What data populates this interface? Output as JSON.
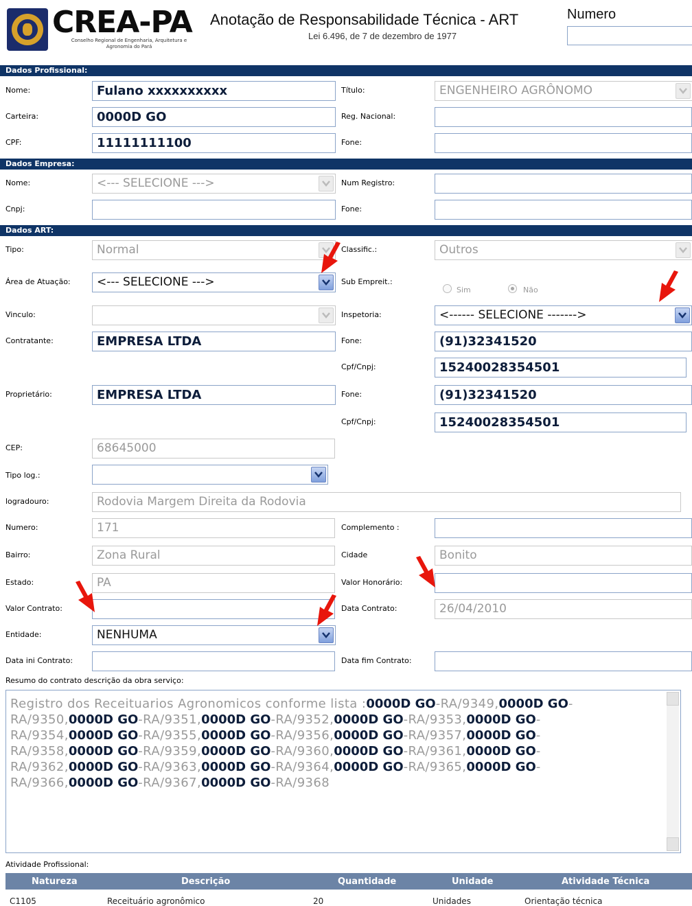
{
  "header": {
    "brand": "CREA-PA",
    "brand_sub": "Conselho Regional de Engenharia, Arquitetura e Agronomia do Pará",
    "title": "Anotação de Responsabilidade Técnica - ART",
    "law": "Lei 6.496, de 7 de dezembro de 1977",
    "numero_label": "Numero",
    "numero_value": ""
  },
  "profissional": {
    "section": "Dados Profissional:",
    "nome_label": "Nome:",
    "nome_value": "Fulano xxxxxxxxxx",
    "titulo_label": "Título:",
    "titulo_value": "ENGENHEIRO AGRÔNOMO",
    "carteira_label": "Carteira:",
    "carteira_value": "0000D GO",
    "reg_label": "Reg. Nacional:",
    "reg_value": "",
    "cpf_label": "CPF:",
    "cpf_value": "11111111100",
    "fone_label": "Fone:",
    "fone_value": ""
  },
  "empresa": {
    "section": "Dados Empresa:",
    "nome_label": "Nome:",
    "nome_value": "<--- SELECIONE --->",
    "num_label": "Num Registro:",
    "num_value": "",
    "cnpj_label": "Cnpj:",
    "cnpj_value": "",
    "fone_label": "Fone:",
    "fone_value": ""
  },
  "art": {
    "section": "Dados ART:",
    "tipo_label": "Tipo:",
    "tipo_value": "Normal",
    "classif_label": "Classific.:",
    "classif_value": "Outros",
    "area_label": "Área de Atuação:",
    "area_value": "<--- SELECIONE --->",
    "sub_label": "Sub Empreit.:",
    "sim_label": "Sim",
    "nao_label": "Não",
    "vinculo_label": "Vinculo:",
    "vinculo_value": "",
    "inspetoria_label": "Inspetoria:",
    "inspetoria_value": "<------ SELECIONE ------->",
    "contratante_label": "Contratante:",
    "contratante_value": "EMPRESA LTDA",
    "fone1_label": "Fone:",
    "fone1_value": "(91)32341520",
    "cpfcnpj1_label": "Cpf/Cnpj:",
    "cpfcnpj1_value": "15240028354501",
    "proprietario_label": "Proprietário:",
    "proprietario_value": "EMPRESA LTDA",
    "fone2_label": "Fone:",
    "fone2_value": "(91)32341520",
    "cpfcnpj2_label": "Cpf/Cnpj:",
    "cpfcnpj2_value": "15240028354501",
    "cep_label": "CEP:",
    "cep_value": "68645000",
    "tipolog_label": "Tipo log.:",
    "tipolog_value": "",
    "logradouro_label": "logradouro:",
    "logradouro_value": "Rodovia Margem Direita da Rodovia",
    "numero_label": "Numero:",
    "numero_value": "171",
    "complemento_label": "Complemento :",
    "complemento_value": "",
    "bairro_label": "Bairro:",
    "bairro_value": "Zona Rural",
    "cidade_label": "Cidade",
    "cidade_value": "Bonito",
    "estado_label": "Estado:",
    "estado_value": "PA",
    "honorario_label": "Valor Honorário:",
    "honorario_value": "",
    "valor_label": "Valor Contrato:",
    "valor_value": "",
    "data_contrato_label": "Data Contrato:",
    "data_contrato_value": "26/04/2010",
    "entidade_label": "Entidade:",
    "entidade_value": "NENHUMA",
    "data_ini_label": "Data ini Contrato:",
    "data_ini_value": "",
    "data_fim_label": "Data fim Contrato:",
    "data_fim_value": "",
    "resumo_label": "Resumo do contrato descrição da obra serviço:",
    "resumo_intro": "Registro dos Receituarios Agronomicos conforme lista :",
    "resumo_code": "0000D GO",
    "resumo_items": [
      "-RA/9349,",
      "-RA/9350,",
      "-RA/9351,",
      "-RA/9352,",
      "-RA/9353,",
      "-RA/9354,",
      "-RA/9355,",
      "-RA/9356,",
      "-RA/9357,",
      "-RA/9358,",
      "-RA/9359,",
      "-RA/9360,",
      "-RA/9361,",
      "-RA/9362,",
      "-RA/9363,",
      "-RA/9364,",
      "-RA/9365,",
      "-RA/9366,",
      "-RA/9367,",
      "-RA/9368"
    ]
  },
  "atividade": {
    "label": "Atividade Profissional:",
    "headers": [
      "Natureza",
      "Descrição",
      "Quantidade",
      "Unidade",
      "Atividade Técnica"
    ],
    "row": [
      "C1105",
      "Receituário agronômico",
      "20",
      "Unidades",
      "Orientação técnica"
    ]
  }
}
